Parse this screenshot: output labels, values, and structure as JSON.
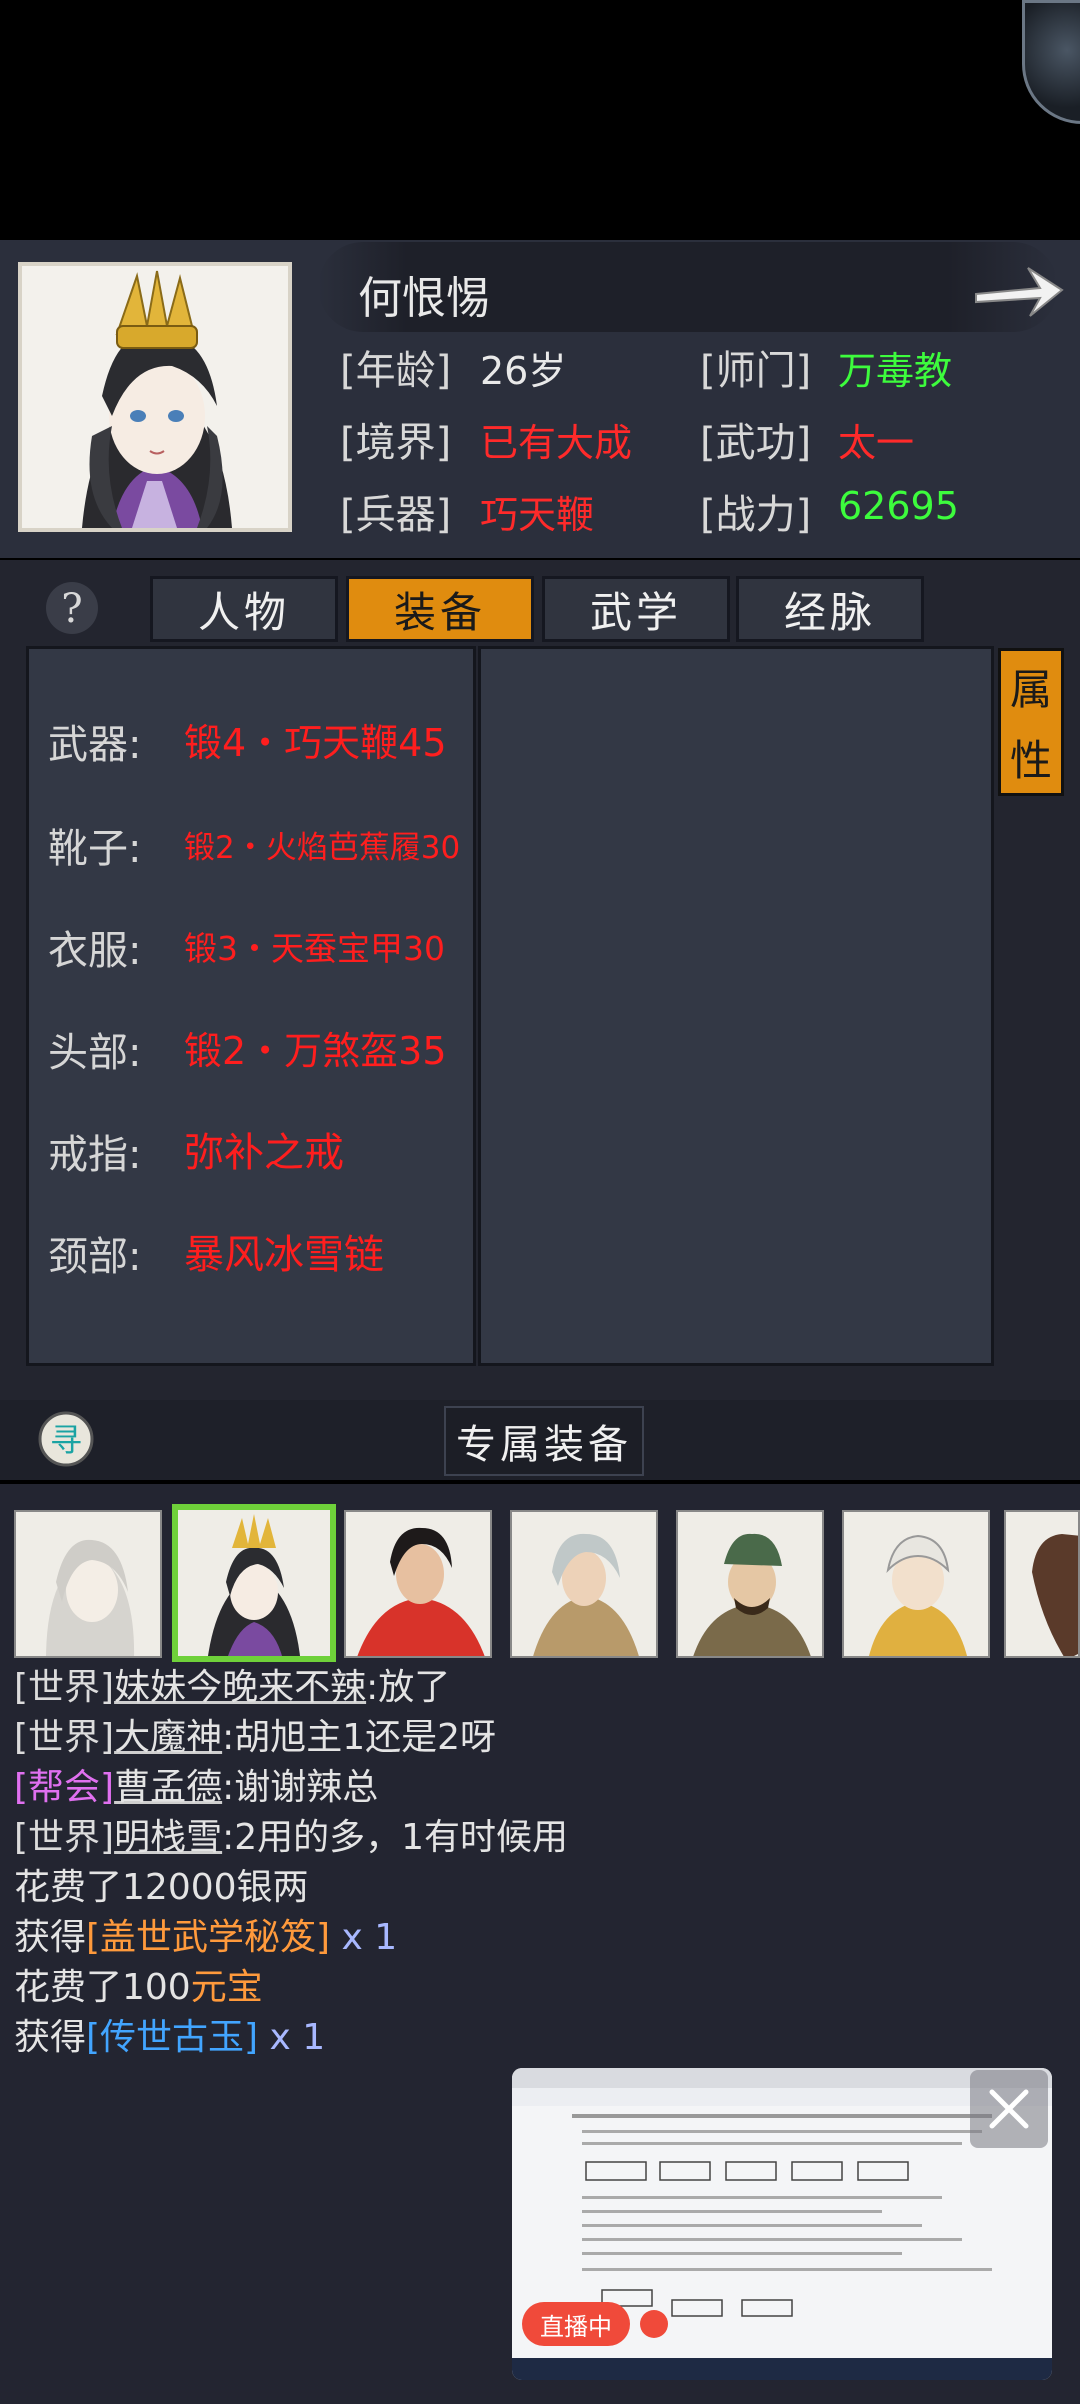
{
  "hero": {
    "name": "何恨惕",
    "age_label": "[年龄]",
    "age": "26岁",
    "sect_label": "[师门]",
    "sect": "万毒教",
    "realm_label": "[境界]",
    "realm": "已有大成",
    "martial_label": "[武功]",
    "martial": "太一",
    "weapon_label": "[兵器]",
    "weapon": "巧天鞭",
    "power_label": "[战力]",
    "power": "62695"
  },
  "tabs": [
    "人物",
    "装备",
    "武学",
    "经脉"
  ],
  "active_tab": 1,
  "attr_button": [
    "属",
    "性"
  ],
  "equipment": [
    {
      "label": "武器:",
      "value": "锻4・巧天鞭45"
    },
    {
      "label": "靴子:",
      "value": "锻2・火焰芭蕉履30"
    },
    {
      "label": "衣服:",
      "value": "锻3・天蚕宝甲30"
    },
    {
      "label": "头部:",
      "value": "锻2・万煞盔35"
    },
    {
      "label": "戒指:",
      "value": "弥补之戒"
    },
    {
      "label": "颈部:",
      "value": "暴风冰雪链"
    }
  ],
  "exclusive_label": "专属装备",
  "xun_icon_char": "寻",
  "chat": [
    {
      "channel": "[世界]",
      "user": "妹妹今晚来不辣",
      "msg": ":放了"
    },
    {
      "channel": "[世界]",
      "user": "大魔神",
      "msg": ":胡旭主1还是2呀"
    },
    {
      "channel": "[帮会]",
      "user": "曹孟德",
      "msg": ":谢谢辣总"
    },
    {
      "channel": "[世界]",
      "user": "明栈雪",
      "msg": ":2用的多，1有时候用"
    }
  ],
  "log": [
    {
      "prefix": "花费了",
      "item": "12000银两",
      "suffix": ""
    },
    {
      "prefix": "获得",
      "item": "[盖世武学秘笈]",
      "suffix": " x 1"
    },
    {
      "prefix": "花费了100",
      "item": "元宝",
      "suffix": ""
    },
    {
      "prefix": "获得",
      "item": "[传世古玉]",
      "suffix": " x 1"
    }
  ],
  "live_badge": "直播中",
  "colors": {
    "accent": "#e08c0f",
    "red_text": "#ff2a2a",
    "green_text": "#3dfc3d",
    "selected_frame": "#6fd13a"
  }
}
